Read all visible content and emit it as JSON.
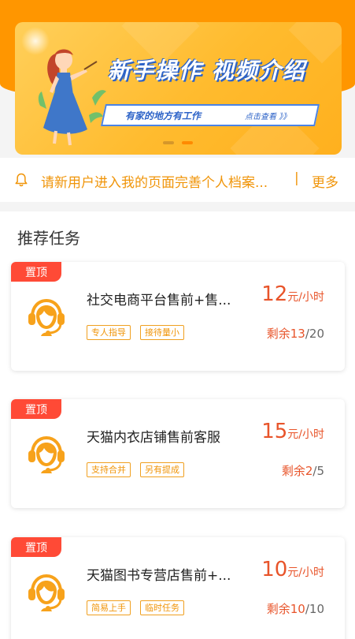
{
  "banner": {
    "title": "新手操作 视频介绍",
    "subtitle": "有家的地方有工作",
    "cta": "点击查看 》》",
    "slides": 2,
    "active_slide": 2
  },
  "notice": {
    "text": "请新用户进入我的页面完善个人档案...",
    "separator": "|",
    "more": "更多"
  },
  "section": {
    "title": "推荐任务"
  },
  "tasks": [
    {
      "pin": "置顶",
      "name": "社交电商平台售前+售...",
      "tags": [
        "专人指导",
        "接待量小"
      ],
      "price": "12",
      "unit": "元/小时",
      "remain_label": "剩余",
      "remain": "13",
      "sep": "/",
      "total": "20"
    },
    {
      "pin": "置顶",
      "name": "天猫内衣店铺售前客服",
      "tags": [
        "支持合并",
        "另有提成"
      ],
      "price": "15",
      "unit": "元/小时",
      "remain_label": "剩余",
      "remain": "2",
      "sep": "/",
      "total": "5"
    },
    {
      "pin": "置顶",
      "name": "天猫图书专营店售前+...",
      "tags": [
        "简易上手",
        "临时任务"
      ],
      "price": "10",
      "unit": "元/小时",
      "remain_label": "剩余",
      "remain": "10",
      "sep": "/",
      "total": "10"
    }
  ],
  "colors": {
    "brand": "#ff9600",
    "price": "#e8542a",
    "pin": "#ff4a36",
    "tag": "#f0950a"
  }
}
